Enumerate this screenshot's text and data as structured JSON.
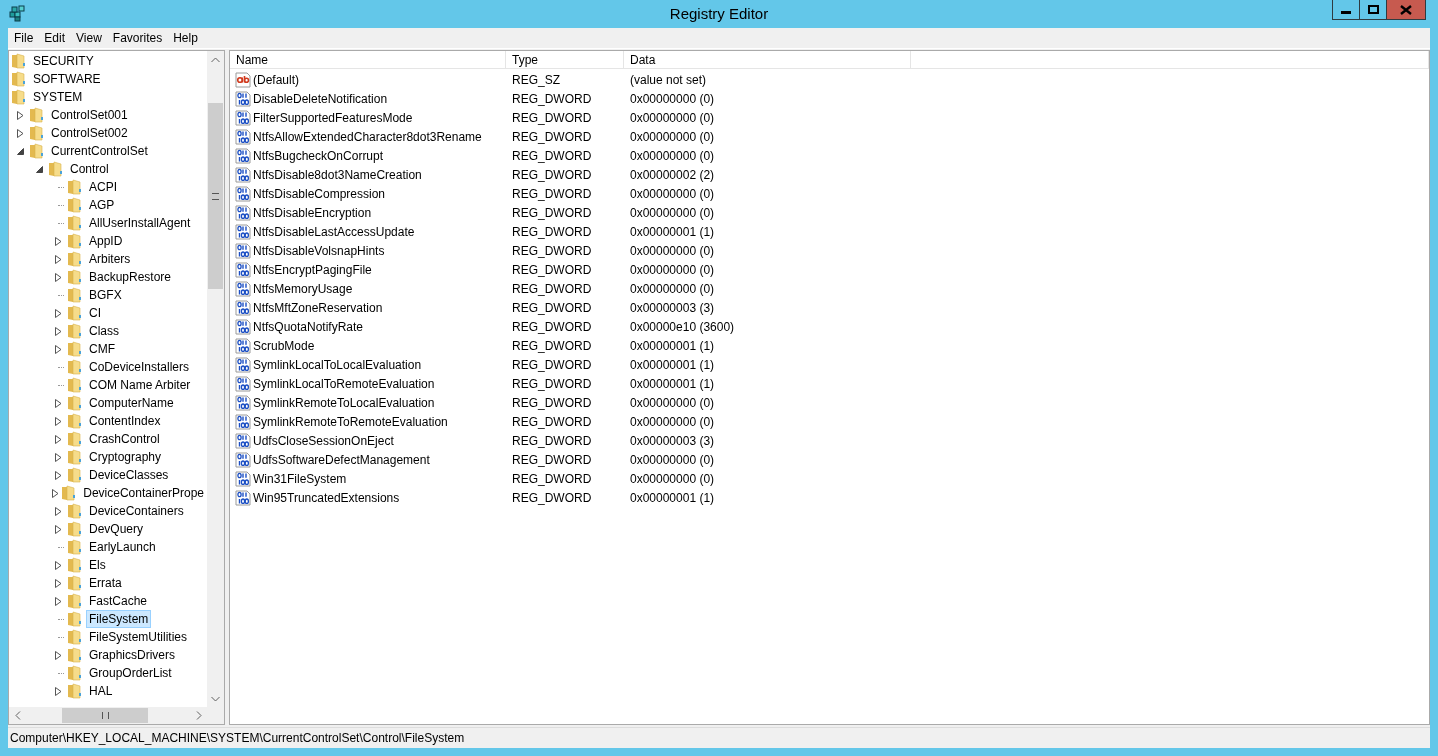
{
  "window": {
    "title": "Registry Editor"
  },
  "menu": [
    "File",
    "Edit",
    "View",
    "Favorites",
    "Help"
  ],
  "tree": {
    "items": [
      {
        "label": "SECURITY",
        "kind": "root",
        "selected": false
      },
      {
        "label": "SOFTWARE",
        "kind": "root",
        "selected": false
      },
      {
        "label": "SYSTEM",
        "kind": "root",
        "selected": false,
        "children": [
          {
            "label": "ControlSet001",
            "kind": "branch",
            "expanded": false,
            "selected": false
          },
          {
            "label": "ControlSet002",
            "kind": "branch",
            "expanded": false,
            "selected": false
          },
          {
            "label": "CurrentControlSet",
            "kind": "branch",
            "expanded": true,
            "selected": false,
            "children": [
              {
                "label": "Control",
                "kind": "branch",
                "expanded": true,
                "selected": false,
                "children": [
                  {
                    "label": "ACPI",
                    "kind": "leaf",
                    "selected": false
                  },
                  {
                    "label": "AGP",
                    "kind": "leaf",
                    "selected": false
                  },
                  {
                    "label": "AllUserInstallAgent",
                    "kind": "leaf",
                    "selected": false
                  },
                  {
                    "label": "AppID",
                    "kind": "branch",
                    "expanded": false,
                    "selected": false
                  },
                  {
                    "label": "Arbiters",
                    "kind": "branch",
                    "expanded": false,
                    "selected": false
                  },
                  {
                    "label": "BackupRestore",
                    "kind": "branch",
                    "expanded": false,
                    "selected": false
                  },
                  {
                    "label": "BGFX",
                    "kind": "leaf",
                    "selected": false
                  },
                  {
                    "label": "CI",
                    "kind": "branch",
                    "expanded": false,
                    "selected": false
                  },
                  {
                    "label": "Class",
                    "kind": "branch",
                    "expanded": false,
                    "selected": false
                  },
                  {
                    "label": "CMF",
                    "kind": "branch",
                    "expanded": false,
                    "selected": false
                  },
                  {
                    "label": "CoDeviceInstallers",
                    "kind": "leaf",
                    "selected": false
                  },
                  {
                    "label": "COM Name Arbiter",
                    "kind": "leaf",
                    "selected": false
                  },
                  {
                    "label": "ComputerName",
                    "kind": "branch",
                    "expanded": false,
                    "selected": false
                  },
                  {
                    "label": "ContentIndex",
                    "kind": "branch",
                    "expanded": false,
                    "selected": false
                  },
                  {
                    "label": "CrashControl",
                    "kind": "branch",
                    "expanded": false,
                    "selected": false
                  },
                  {
                    "label": "Cryptography",
                    "kind": "branch",
                    "expanded": false,
                    "selected": false
                  },
                  {
                    "label": "DeviceClasses",
                    "kind": "branch",
                    "expanded": false,
                    "selected": false
                  },
                  {
                    "label": "DeviceContainerPrope",
                    "kind": "branch",
                    "expanded": false,
                    "selected": false
                  },
                  {
                    "label": "DeviceContainers",
                    "kind": "branch",
                    "expanded": false,
                    "selected": false
                  },
                  {
                    "label": "DevQuery",
                    "kind": "branch",
                    "expanded": false,
                    "selected": false
                  },
                  {
                    "label": "EarlyLaunch",
                    "kind": "leaf",
                    "selected": false
                  },
                  {
                    "label": "Els",
                    "kind": "branch",
                    "expanded": false,
                    "selected": false
                  },
                  {
                    "label": "Errata",
                    "kind": "branch",
                    "expanded": false,
                    "selected": false
                  },
                  {
                    "label": "FastCache",
                    "kind": "branch",
                    "expanded": false,
                    "selected": false
                  },
                  {
                    "label": "FileSystem",
                    "kind": "leaf",
                    "selected": true
                  },
                  {
                    "label": "FileSystemUtilities",
                    "kind": "leaf",
                    "selected": false
                  },
                  {
                    "label": "GraphicsDrivers",
                    "kind": "branch",
                    "expanded": false,
                    "selected": false
                  },
                  {
                    "label": "GroupOrderList",
                    "kind": "leaf",
                    "selected": false
                  },
                  {
                    "label": "HAL",
                    "kind": "branch",
                    "expanded": false,
                    "selected": false
                  }
                ]
              }
            ]
          }
        ]
      }
    ]
  },
  "values": {
    "columns": [
      "Name",
      "Type",
      "Data"
    ],
    "rows": [
      {
        "kind": "string",
        "name": "(Default)",
        "type": "REG_SZ",
        "data": "(value not set)"
      },
      {
        "kind": "binary",
        "name": "DisableDeleteNotification",
        "type": "REG_DWORD",
        "data": "0x00000000 (0)"
      },
      {
        "kind": "binary",
        "name": "FilterSupportedFeaturesMode",
        "type": "REG_DWORD",
        "data": "0x00000000 (0)"
      },
      {
        "kind": "binary",
        "name": "NtfsAllowExtendedCharacter8dot3Rename",
        "type": "REG_DWORD",
        "data": "0x00000000 (0)"
      },
      {
        "kind": "binary",
        "name": "NtfsBugcheckOnCorrupt",
        "type": "REG_DWORD",
        "data": "0x00000000 (0)"
      },
      {
        "kind": "binary",
        "name": "NtfsDisable8dot3NameCreation",
        "type": "REG_DWORD",
        "data": "0x00000002 (2)"
      },
      {
        "kind": "binary",
        "name": "NtfsDisableCompression",
        "type": "REG_DWORD",
        "data": "0x00000000 (0)"
      },
      {
        "kind": "binary",
        "name": "NtfsDisableEncryption",
        "type": "REG_DWORD",
        "data": "0x00000000 (0)"
      },
      {
        "kind": "binary",
        "name": "NtfsDisableLastAccessUpdate",
        "type": "REG_DWORD",
        "data": "0x00000001 (1)"
      },
      {
        "kind": "binary",
        "name": "NtfsDisableVolsnapHints",
        "type": "REG_DWORD",
        "data": "0x00000000 (0)"
      },
      {
        "kind": "binary",
        "name": "NtfsEncryptPagingFile",
        "type": "REG_DWORD",
        "data": "0x00000000 (0)"
      },
      {
        "kind": "binary",
        "name": "NtfsMemoryUsage",
        "type": "REG_DWORD",
        "data": "0x00000000 (0)"
      },
      {
        "kind": "binary",
        "name": "NtfsMftZoneReservation",
        "type": "REG_DWORD",
        "data": "0x00000003 (3)"
      },
      {
        "kind": "binary",
        "name": "NtfsQuotaNotifyRate",
        "type": "REG_DWORD",
        "data": "0x00000e10 (3600)"
      },
      {
        "kind": "binary",
        "name": "ScrubMode",
        "type": "REG_DWORD",
        "data": "0x00000001 (1)"
      },
      {
        "kind": "binary",
        "name": "SymlinkLocalToLocalEvaluation",
        "type": "REG_DWORD",
        "data": "0x00000001 (1)"
      },
      {
        "kind": "binary",
        "name": "SymlinkLocalToRemoteEvaluation",
        "type": "REG_DWORD",
        "data": "0x00000001 (1)"
      },
      {
        "kind": "binary",
        "name": "SymlinkRemoteToLocalEvaluation",
        "type": "REG_DWORD",
        "data": "0x00000000 (0)"
      },
      {
        "kind": "binary",
        "name": "SymlinkRemoteToRemoteEvaluation",
        "type": "REG_DWORD",
        "data": "0x00000000 (0)"
      },
      {
        "kind": "binary",
        "name": "UdfsCloseSessionOnEject",
        "type": "REG_DWORD",
        "data": "0x00000003 (3)"
      },
      {
        "kind": "binary",
        "name": "UdfsSoftwareDefectManagement",
        "type": "REG_DWORD",
        "data": "0x00000000 (0)"
      },
      {
        "kind": "binary",
        "name": "Win31FileSystem",
        "type": "REG_DWORD",
        "data": "0x00000000 (0)"
      },
      {
        "kind": "binary",
        "name": "Win95TruncatedExtensions",
        "type": "REG_DWORD",
        "data": "0x00000001 (1)"
      }
    ]
  },
  "status_bar": "Computer\\HKEY_LOCAL_MACHINE\\SYSTEM\\CurrentControlSet\\Control\\FileSystem"
}
